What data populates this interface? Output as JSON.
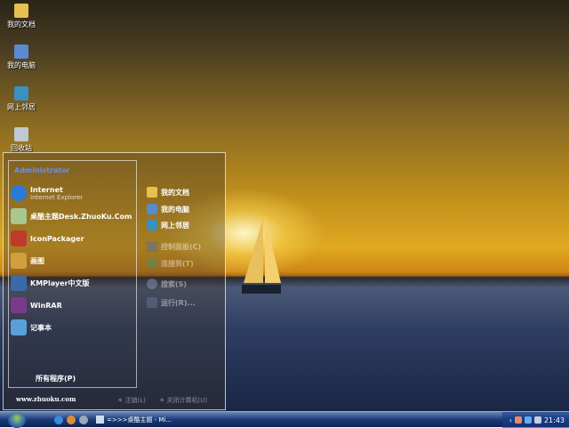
{
  "desktop_icons": [
    {
      "label": "我的文档",
      "icon": "folder-icon"
    },
    {
      "label": "我的电脑",
      "icon": "computer-icon"
    },
    {
      "label": "网上邻居",
      "icon": "network-icon"
    },
    {
      "label": "回收站",
      "icon": "recycle-bin-icon"
    }
  ],
  "start_menu": {
    "user": "Administrator",
    "programs": [
      {
        "label": "Internet",
        "sub": "Internet Explorer",
        "icon": "ie-icon",
        "color": "#2a7ad8"
      },
      {
        "label": "桌酷主题Desk.ZhuoKu.Com",
        "icon": "theme-icon",
        "color": "#a8c890"
      },
      {
        "label": "IconPackager",
        "icon": "iconpackager-icon",
        "color": "#c03a2a"
      },
      {
        "label": "画图",
        "icon": "paint-icon",
        "color": "#d0a040"
      },
      {
        "label": "KMPlayer中文版",
        "icon": "kmplayer-icon",
        "color": "#3a6aa8"
      },
      {
        "label": "WinRAR",
        "icon": "winrar-icon",
        "color": "#7a3a8a"
      },
      {
        "label": "记事本",
        "icon": "notepad-icon",
        "color": "#5aa0d8"
      }
    ],
    "all_programs": "所有程序(P)",
    "places": [
      {
        "label": "我的文档",
        "icon": "folder-icon",
        "faint": false
      },
      {
        "label": "我的电脑",
        "icon": "computer-icon",
        "faint": false
      },
      {
        "label": "网上邻居",
        "icon": "network-icon",
        "faint": false
      },
      {
        "label": "控制面板(C)",
        "icon": "control-panel-icon",
        "faint": true
      },
      {
        "label": "连接到(T)",
        "icon": "connect-icon",
        "faint": true
      },
      {
        "label": "搜索(S)",
        "icon": "search-icon",
        "faint": true
      },
      {
        "label": "运行(R)...",
        "icon": "run-icon",
        "faint": true
      }
    ],
    "website": "www.zhuoku.com",
    "logoff": "注销(L)",
    "shutdown": "关闭计算机(U)"
  },
  "taskbar": {
    "task": "=>>>桌酷主题 - Mi...",
    "clock": "21:43"
  }
}
